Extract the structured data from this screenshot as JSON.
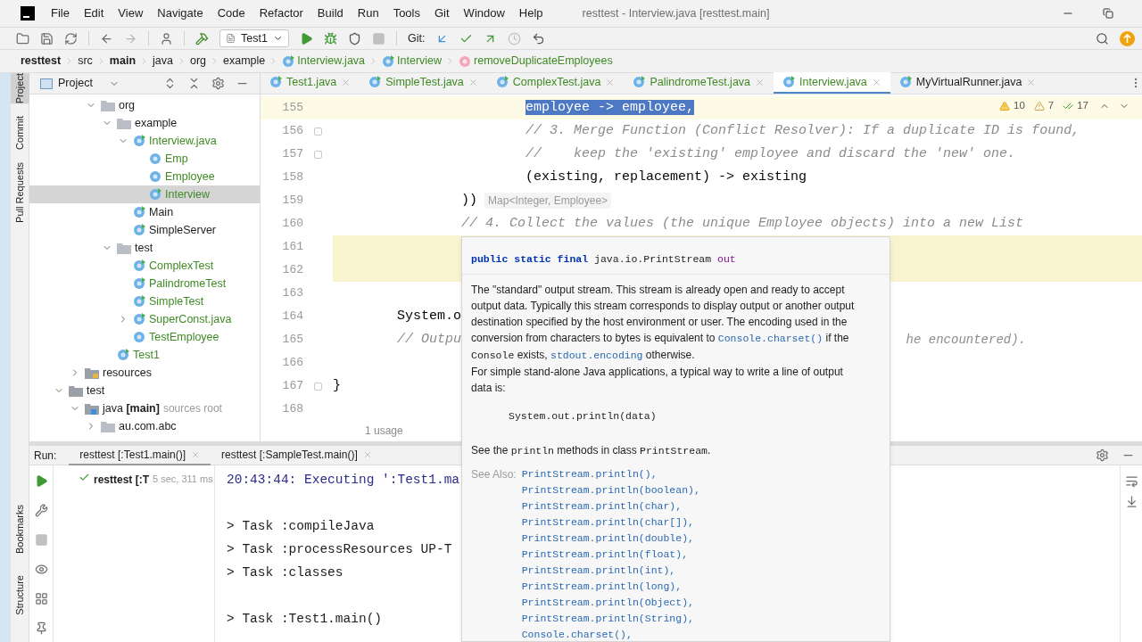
{
  "window": {
    "title": "resttest - Interview.java [resttest.main]"
  },
  "menu": [
    "File",
    "Edit",
    "View",
    "Navigate",
    "Code",
    "Refactor",
    "Build",
    "Run",
    "Tools",
    "Git",
    "Window",
    "Help"
  ],
  "toolbar": {
    "run_config": "Test1",
    "git_label": "Git:"
  },
  "breadcrumb": [
    {
      "label": "resttest",
      "kind": "module"
    },
    {
      "label": "src",
      "kind": "dir"
    },
    {
      "label": "main",
      "kind": "module"
    },
    {
      "label": "java",
      "kind": "dir"
    },
    {
      "label": "org",
      "kind": "dir"
    },
    {
      "label": "example",
      "kind": "dir"
    },
    {
      "label": "Interview.java",
      "kind": "file"
    },
    {
      "label": "Interview",
      "kind": "class"
    },
    {
      "label": "removeDuplicateEmployees",
      "kind": "method"
    }
  ],
  "side_tools_top": [
    {
      "label": "Project",
      "selected": true
    },
    {
      "label": "Commit",
      "selected": false
    },
    {
      "label": "Pull Requests",
      "selected": false
    }
  ],
  "side_tools_bottom": [
    {
      "label": "Bookmarks"
    },
    {
      "label": "Structure"
    }
  ],
  "project_panel": {
    "title": "Project",
    "tree": [
      {
        "children": [
          {
            "children": [
              {
                "children": [
                  {
                    "label": "org",
                    "kind": "folder",
                    "expanded": true,
                    "added": false,
                    "selected": false,
                    "children": [
                      {
                        "label": "example",
                        "kind": "folder",
                        "expanded": true,
                        "added": false,
                        "selected": false,
                        "children": [
                          {
                            "label": "Interview.java",
                            "kind": "runnable",
                            "expanded": true,
                            "added": true,
                            "selected": false,
                            "children": [
                              {
                                "label": "Emp",
                                "kind": "record",
                                "added": true,
                                "selected": false
                              },
                              {
                                "label": "Employee",
                                "kind": "class",
                                "added": true,
                                "selected": false
                              },
                              {
                                "label": "Interview",
                                "kind": "runnable",
                                "added": true,
                                "selected": true
                              }
                            ]
                          },
                          {
                            "label": "Main",
                            "kind": "runnable",
                            "added": false,
                            "selected": false
                          },
                          {
                            "label": "SimpleServer",
                            "kind": "runnable",
                            "added": false,
                            "selected": false
                          }
                        ]
                      },
                      {
                        "label": "test",
                        "kind": "folder",
                        "expanded": true,
                        "added": false,
                        "selected": false,
                        "children": [
                          {
                            "label": "ComplexTest",
                            "kind": "runnable",
                            "added": true,
                            "selected": false
                          },
                          {
                            "label": "PalindromeTest",
                            "kind": "runnable",
                            "added": true,
                            "selected": false
                          },
                          {
                            "label": "SimpleTest",
                            "kind": "runnable",
                            "added": true,
                            "selected": false
                          },
                          {
                            "label": "SuperConst.java",
                            "kind": "runnable",
                            "expanded": false,
                            "added": true,
                            "selected": false
                          },
                          {
                            "label": "TestEmployee",
                            "kind": "record",
                            "added": true,
                            "selected": false
                          }
                        ]
                      },
                      {
                        "label": "Test1",
                        "kind": "runnable",
                        "added": true,
                        "selected": false
                      }
                    ]
                  }
                ]
              },
              {
                "label": "resources",
                "kind": "resources",
                "expanded": false,
                "added": false,
                "selected": false
              }
            ]
          },
          {
            "label": "test",
            "kind": "plain-folder",
            "expanded": true,
            "added": false,
            "selected": false,
            "children": [
              {
                "label": "java **[main]**",
                "note": "sources root",
                "kind": "source-root",
                "expanded": true,
                "added": false,
                "selected": false,
                "children": [
                  {
                    "label": "au.com.abc",
                    "kind": "folder",
                    "expanded": false,
                    "added": false,
                    "selected": false
                  }
                ]
              }
            ]
          }
        ]
      }
    ]
  },
  "editor": {
    "tabs": [
      {
        "label": "Test1.java",
        "selected": false
      },
      {
        "label": "SimpleTest.java",
        "selected": false
      },
      {
        "label": "ComplexTest.java",
        "selected": false
      },
      {
        "label": "PalindromeTest.java",
        "selected": false
      },
      {
        "label": "Interview.java",
        "selected": true
      },
      {
        "label": "MyVirtualRunner.java",
        "selected": false
      }
    ],
    "inspections": {
      "warnings": "10",
      "weak_warnings": "7",
      "typos": "17"
    },
    "lines": [
      {
        "number": "155",
        "code": "                        employee -> employee,",
        "kind": "code",
        "selection": true,
        "highlight": false,
        "fold": false
      },
      {
        "number": "156",
        "code": "                        // 3. Merge Function (Conflict Resolver): If a duplicate ID is found,",
        "kind": "comment",
        "selection": false,
        "highlight": false,
        "fold": true
      },
      {
        "number": "157",
        "code": "                        //    keep the 'existing' employee and discard the 'new' one.",
        "kind": "comment",
        "selection": false,
        "highlight": false,
        "fold": true
      },
      {
        "number": "158",
        "code": "                        (existing, replacement) -> existing",
        "kind": "code",
        "selection": false,
        "highlight": false,
        "fold": false
      },
      {
        "number": "159",
        "code": "                ))",
        "hint": "Map<Integer, Employee>",
        "kind": "code",
        "selection": false,
        "highlight": false,
        "fold": false
      },
      {
        "number": "160",
        "code": "                // 4. Collect the values (the unique Employee objects) into a new List",
        "kind": "comment",
        "selection": false,
        "highlight": false,
        "fold": false
      },
      {
        "number": "161",
        "selection": false,
        "highlight": true,
        "fold": false
      },
      {
        "number": "162",
        "selection": false,
        "highlight": true,
        "fold": false
      },
      {
        "number": "163",
        "selection": false,
        "highlight": false,
        "fold": false
      },
      {
        "number": "164",
        "code": "        System.o",
        "kind": "code",
        "selection": false,
        "highlight": false,
        "fold": false
      },
      {
        "number": "165",
        "code": "        // Outpu",
        "tail": "he encountered).",
        "kind": "comment",
        "selection": false,
        "highlight": false,
        "fold": false
      },
      {
        "number": "166",
        "selection": false,
        "highlight": false,
        "fold": false
      },
      {
        "number": "167",
        "code": "}",
        "kind": "code",
        "selection": false,
        "highlight": false,
        "fold": true
      },
      {
        "number": "168",
        "selection": false,
        "highlight": false,
        "fold": false
      }
    ],
    "usage_hint": "1 usage"
  },
  "popup": {
    "signature": {
      "modifiers": "public static final",
      "type": "java.io.PrintStream",
      "name": "out"
    },
    "paragraphs": [
      [
        {
          "kind": "text",
          "text": "The \"standard\" output stream. This stream is already open and ready to accept output data. Typically this stream corresponds to display output or another output destination specified by the host environment or user. The encoding used in the conversion from characters to bytes is equivalent to "
        },
        {
          "kind": "link",
          "text": "Console.charset()"
        },
        {
          "kind": "text",
          "text": " if the "
        },
        {
          "kind": "code",
          "text": "Console"
        },
        {
          "kind": "text",
          "text": " exists, "
        },
        {
          "kind": "link",
          "text": "stdout.encoding"
        },
        {
          "kind": "text",
          "text": " otherwise."
        }
      ],
      [
        {
          "kind": "text",
          "text": "For simple stand-alone Java applications, a typical way to write a line of output data is:"
        }
      ]
    ],
    "code_sample": "System.out.println(data)",
    "see_line": [
      {
        "kind": "text",
        "text": "See the "
      },
      {
        "kind": "code",
        "text": "println"
      },
      {
        "kind": "text",
        "text": " methods in class "
      },
      {
        "kind": "code",
        "text": "PrintStream"
      },
      {
        "kind": "text",
        "text": "."
      }
    ],
    "see_also_label": "See Also:",
    "see_also": [
      "PrintStream.println(),",
      "PrintStream.println(boolean),",
      "PrintStream.println(char),",
      "PrintStream.println(char[]),",
      "PrintStream.println(double),",
      "PrintStream.println(float),",
      "PrintStream.println(int),",
      "PrintStream.println(long),",
      "PrintStream.println(Object),",
      "PrintStream.println(String),",
      "Console.charset(),"
    ]
  },
  "run_panel": {
    "label": "Run:",
    "tabs": [
      {
        "label": "resttest [:Test1.main()]",
        "selected": true
      },
      {
        "label": "resttest [:SampleTest.main()]",
        "selected": false
      }
    ],
    "tree": {
      "label": "resttest [:T",
      "time": "5 sec, 311 ms",
      "passed": true
    },
    "console": [
      {
        "text": "20:43:44: Executing ':Test1.ma",
        "kind": "info"
      },
      {
        "kind": "blank"
      },
      {
        "text": "> Task :compileJava",
        "kind": "output"
      },
      {
        "text": "> Task :processResources UP-T",
        "kind": "output"
      },
      {
        "text": "> Task :classes",
        "kind": "output"
      },
      {
        "kind": "blank"
      },
      {
        "text": "> Task :Test1.main()",
        "kind": "output"
      }
    ]
  }
}
